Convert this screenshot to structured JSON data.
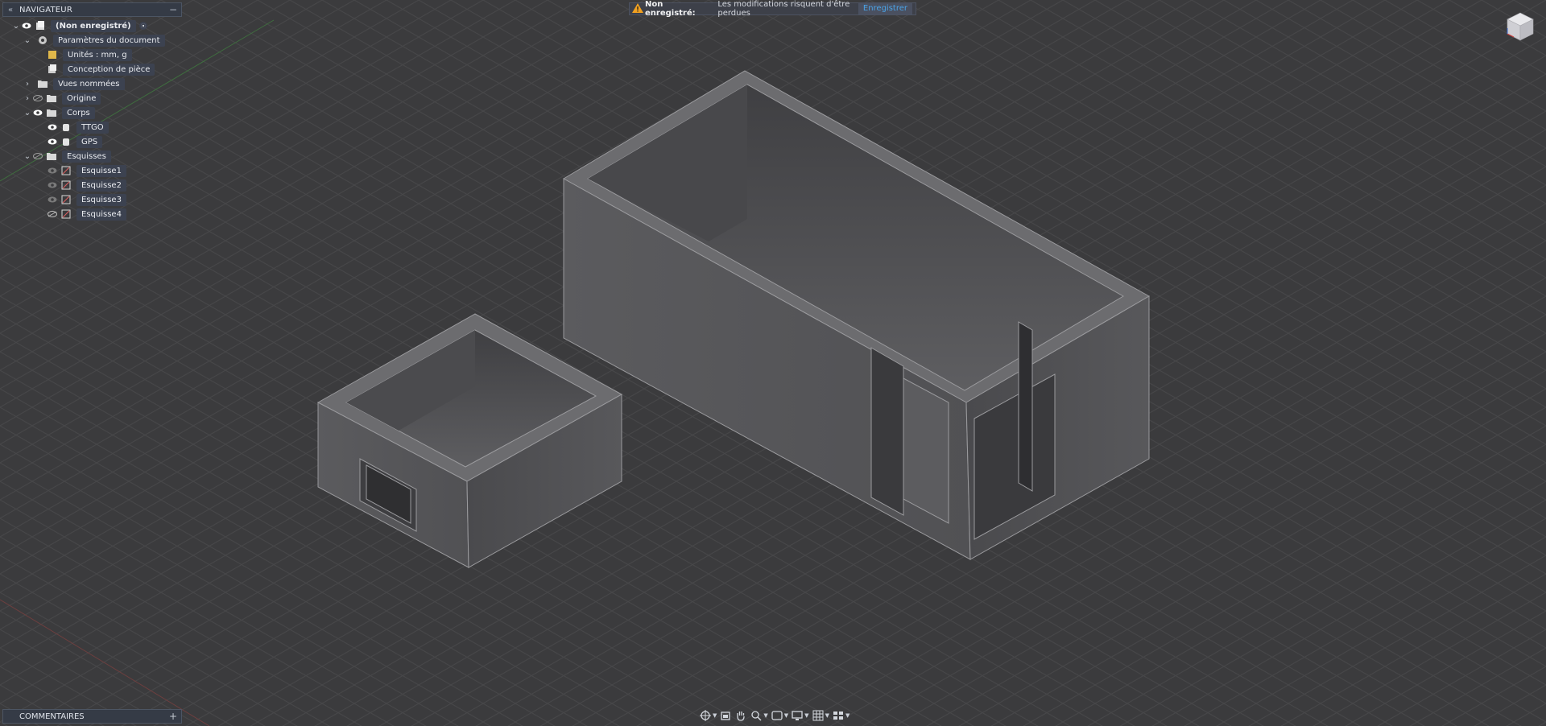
{
  "browser": {
    "title": "NAVIGATEUR",
    "collapse_glyph": "«",
    "minimize_glyph": "−",
    "tree": [
      {
        "label": "(Non enregistré)",
        "icon": "document-icon",
        "expanded": true
      },
      {
        "label": "Paramètres du document",
        "icon": "gear-icon",
        "expanded": true
      },
      {
        "label": "Unités : mm, g",
        "icon": "units-icon"
      },
      {
        "label": "Conception de pièce",
        "icon": "part-design-icon"
      },
      {
        "label": "Vues nommées",
        "icon": "folder-icon",
        "expanded": false
      },
      {
        "label": "Origine",
        "icon": "folder-icon",
        "expanded": false,
        "visible": false
      },
      {
        "label": "Corps",
        "icon": "folder-icon",
        "expanded": true,
        "visible": true
      },
      {
        "label": "TTGO",
        "icon": "body-icon",
        "visible": true
      },
      {
        "label": "GPS",
        "icon": "body-icon",
        "visible": true
      },
      {
        "label": "Esquisses",
        "icon": "folder-icon",
        "expanded": true,
        "visible": false
      },
      {
        "label": "Esquisse1",
        "icon": "sketch-icon",
        "visible": false
      },
      {
        "label": "Esquisse2",
        "icon": "sketch-icon",
        "visible": false
      },
      {
        "label": "Esquisse3",
        "icon": "sketch-icon",
        "visible": false
      },
      {
        "label": "Esquisse4",
        "icon": "sketch-icon",
        "visible": false
      }
    ]
  },
  "notice": {
    "title": "Non enregistré:",
    "message": "Les modifications risquent d'être perdues",
    "action": "Enregistrer",
    "warn_color": "#f0a020"
  },
  "comments": {
    "title": "COMMENTAIRES",
    "add_glyph": "+"
  },
  "toolbar": {
    "items": [
      "orbit-icon",
      "look-at-icon",
      "pan-icon",
      "zoom-icon",
      "display-mode-icon",
      "visual-style-icon",
      "grid-icon",
      "viewports-icon"
    ]
  },
  "colors": {
    "background": "#3b3b3d",
    "grid": "#4a4a4c",
    "body": "#6a6a6c",
    "accent": "#4aa3e6"
  }
}
